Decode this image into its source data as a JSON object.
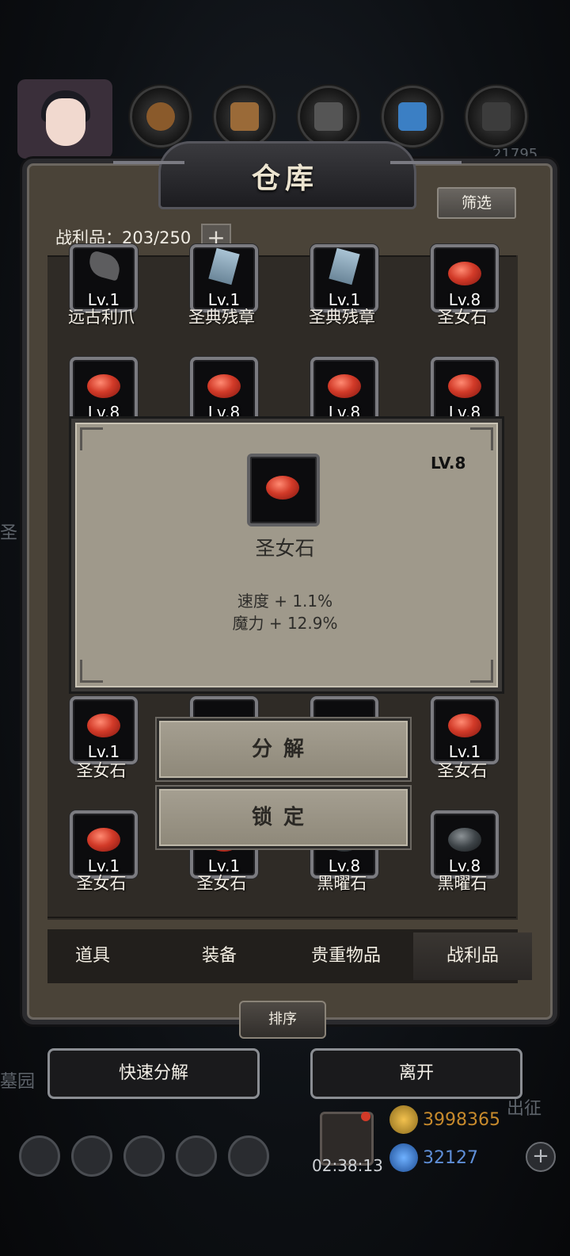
{
  "window": {
    "title": "仓库",
    "filter_label": "筛选",
    "count_label": "战利品：203/250",
    "plus": "+"
  },
  "items": [
    {
      "lv": "Lv.1",
      "name": "远古利爪",
      "kind": "claw"
    },
    {
      "lv": "Lv.1",
      "name": "圣典残章",
      "kind": "page"
    },
    {
      "lv": "Lv.1",
      "name": "圣典残章",
      "kind": "page"
    },
    {
      "lv": "Lv.8",
      "name": "圣女石",
      "kind": "red"
    },
    {
      "lv": "Lv.8",
      "name": "",
      "kind": "red"
    },
    {
      "lv": "Lv.8",
      "name": "",
      "kind": "red"
    },
    {
      "lv": "Lv.8",
      "name": "",
      "kind": "red"
    },
    {
      "lv": "Lv.8",
      "name": "",
      "kind": "red"
    },
    {
      "lv": "Lv.1",
      "name": "圣女石",
      "kind": "red"
    },
    {
      "lv": "Lv.1",
      "name": "圣女石",
      "kind": "red"
    },
    {
      "lv": "Lv.1",
      "name": "圣女石",
      "kind": "red"
    },
    {
      "lv": "Lv.1",
      "name": "圣女石",
      "kind": "red"
    },
    {
      "lv": "Lv.8",
      "name": "黑曜石",
      "kind": "black"
    },
    {
      "lv": "Lv.8",
      "name": "黑曜石",
      "kind": "black"
    }
  ],
  "popup": {
    "level": "LV.8",
    "name": "圣女石",
    "stats": [
      "速度 + 1.1%",
      "魔力 + 12.9%"
    ]
  },
  "actions": {
    "decompose": "分解",
    "lock": "锁定"
  },
  "tabs": [
    "道具",
    "装备",
    "贵重物品",
    "战利品"
  ],
  "sort_label": "排序",
  "bottom": {
    "quick_decompose": "快速分解",
    "leave": "离开"
  },
  "hud": {
    "timer": "02:38:13",
    "gold": "3998365",
    "gems": "32127",
    "plus": "+"
  },
  "background_text": {
    "left1": "圣",
    "left2": "墓园",
    "right": "出征",
    "topright": "21795"
  },
  "colors": {
    "gold_text": "#c78a2c",
    "gem_text": "#5f8fd8",
    "accent_red": "#d23a28"
  }
}
